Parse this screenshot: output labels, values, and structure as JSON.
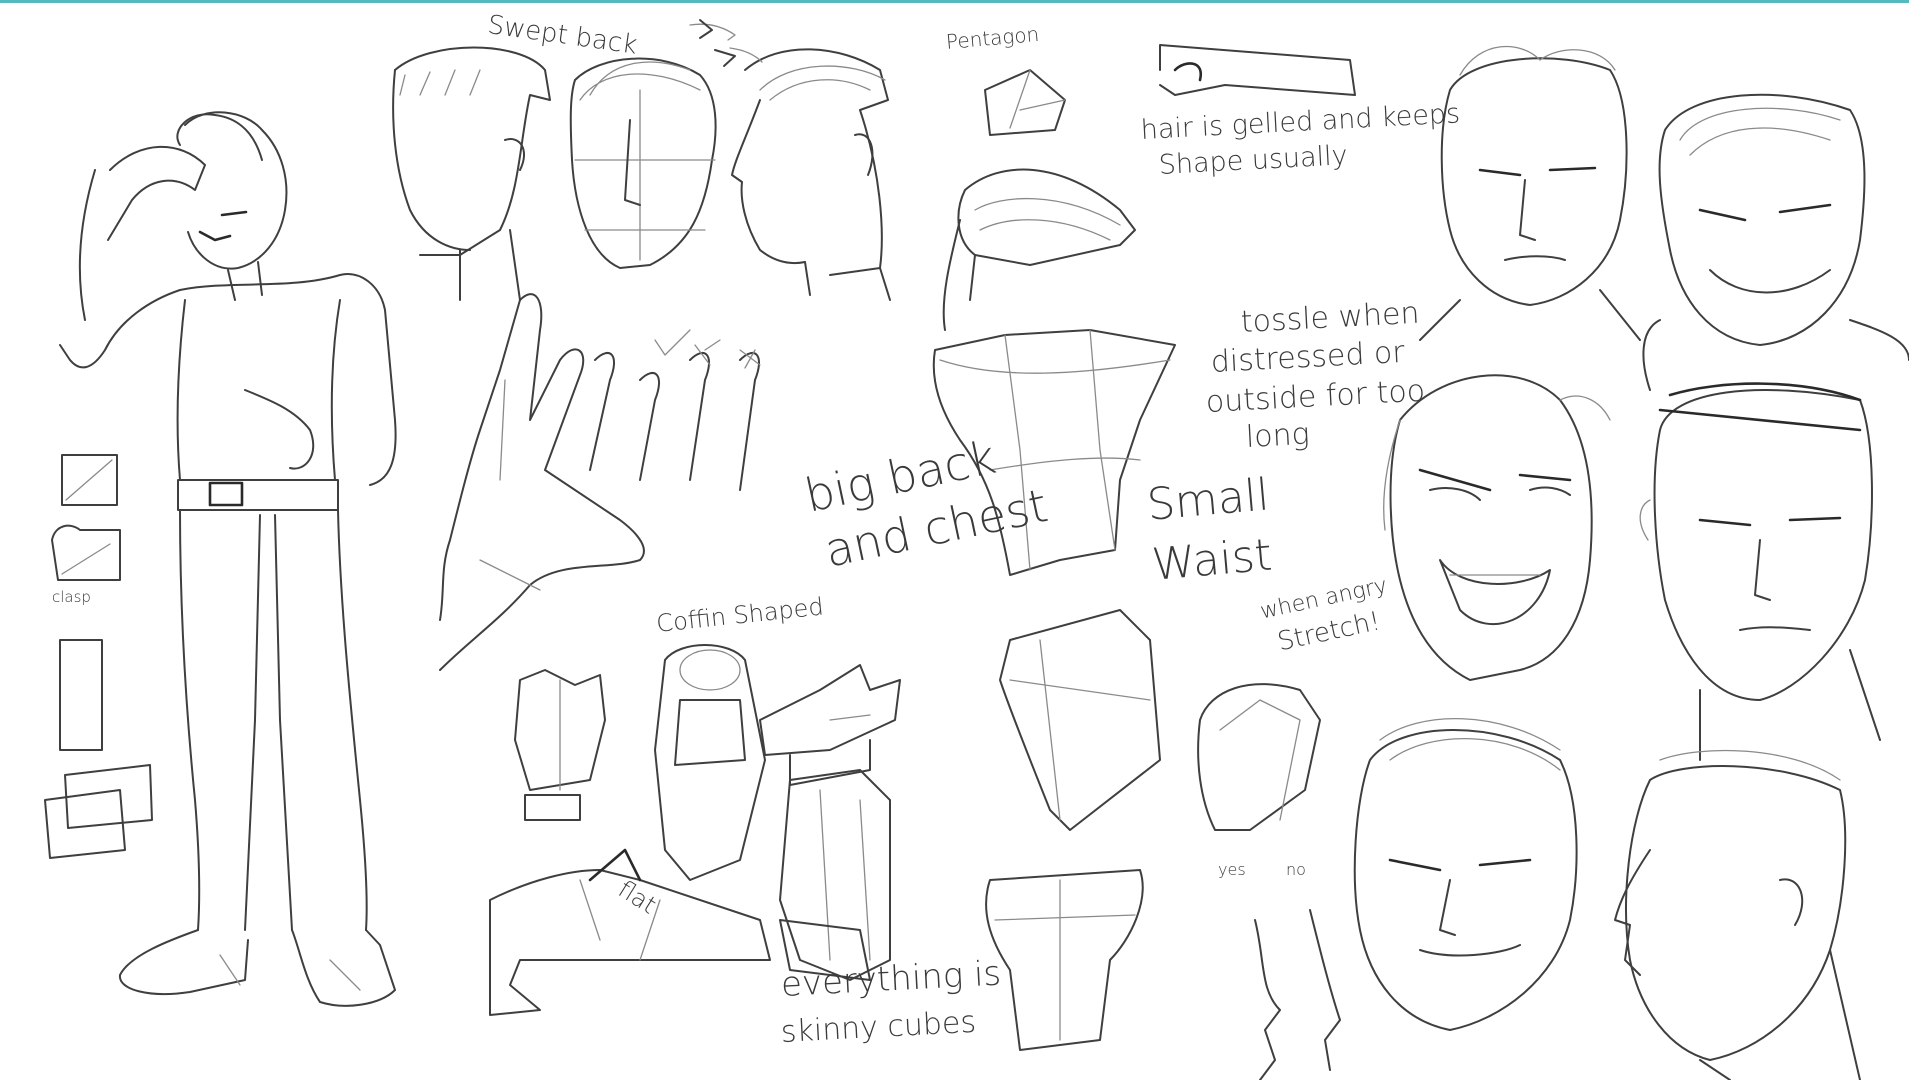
{
  "colors": {
    "accent_bar": "#56b9bd",
    "pencil": "#3f3f3f",
    "paper": "#ffffff"
  },
  "notes": {
    "swept_back": "Swept back",
    "pentagon": "Pentagon",
    "hair_gelled": "hair is gelled and keeps",
    "shape_usually": "Shape usually",
    "tossle": "tossle when",
    "distressed": "distressed or",
    "outside": "outside for too",
    "long": "long",
    "clasp": "clasp",
    "big_back": "big back",
    "and_chest": "and chest",
    "small": "Small",
    "waist": "Waist",
    "coffin_shaped": "Coffin Shaped",
    "when_angry": "when angry",
    "stretch": "Stretch!",
    "flat": "flat",
    "everything_is": "everything is",
    "skinny_cubes": "skinny cubes",
    "yes": "yes",
    "no": "no"
  }
}
